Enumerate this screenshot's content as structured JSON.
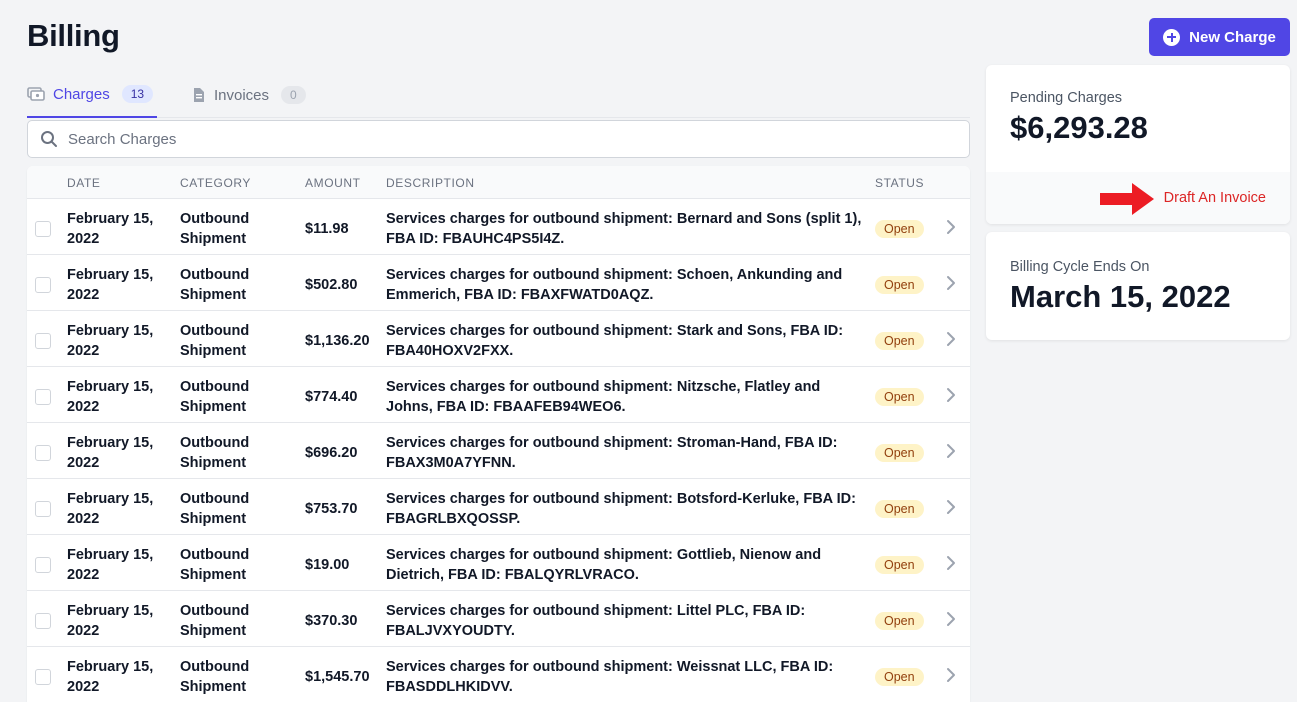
{
  "page": {
    "title": "Billing"
  },
  "actions": {
    "new_charge_label": "New Charge"
  },
  "tabs": [
    {
      "label": "Charges",
      "count": "13",
      "active": true
    },
    {
      "label": "Invoices",
      "count": "0",
      "active": false
    }
  ],
  "search": {
    "placeholder": "Search Charges",
    "value": ""
  },
  "table": {
    "headers": {
      "date": "DATE",
      "category": "CATEGORY",
      "amount": "AMOUNT",
      "description": "DESCRIPTION",
      "status": "STATUS"
    },
    "rows": [
      {
        "date": "February 15, 2022",
        "category": "Outbound Shipment",
        "amount": "$11.98",
        "description": "Services charges for outbound shipment: Bernard and Sons (split 1), FBA ID: FBAUHC4PS5I4Z.",
        "status": "Open"
      },
      {
        "date": "February 15, 2022",
        "category": "Outbound Shipment",
        "amount": "$502.80",
        "description": "Services charges for outbound shipment: Schoen, Ankunding and Emmerich, FBA ID: FBAXFWATD0AQZ.",
        "status": "Open"
      },
      {
        "date": "February 15, 2022",
        "category": "Outbound Shipment",
        "amount": "$1,136.20",
        "description": "Services charges for outbound shipment: Stark and Sons, FBA ID: FBA40HOXV2FXX.",
        "status": "Open"
      },
      {
        "date": "February 15, 2022",
        "category": "Outbound Shipment",
        "amount": "$774.40",
        "description": "Services charges for outbound shipment: Nitzsche, Flatley and Johns, FBA ID: FBAAFEB94WEO6.",
        "status": "Open"
      },
      {
        "date": "February 15, 2022",
        "category": "Outbound Shipment",
        "amount": "$696.20",
        "description": "Services charges for outbound shipment: Stroman-Hand, FBA ID: FBAX3M0A7YFNN.",
        "status": "Open"
      },
      {
        "date": "February 15, 2022",
        "category": "Outbound Shipment",
        "amount": "$753.70",
        "description": "Services charges for outbound shipment: Botsford-Kerluke, FBA ID: FBAGRLBXQOSSP.",
        "status": "Open"
      },
      {
        "date": "February 15, 2022",
        "category": "Outbound Shipment",
        "amount": "$19.00",
        "description": "Services charges for outbound shipment: Gottlieb, Nienow and Dietrich, FBA ID: FBALQYRLVRACO.",
        "status": "Open"
      },
      {
        "date": "February 15, 2022",
        "category": "Outbound Shipment",
        "amount": "$370.30",
        "description": "Services charges for outbound shipment: Littel PLC, FBA ID: FBALJVXYOUDTY.",
        "status": "Open"
      },
      {
        "date": "February 15, 2022",
        "category": "Outbound Shipment",
        "amount": "$1,545.70",
        "description": "Services charges for outbound shipment: Weissnat LLC, FBA ID: FBASDDLHKIDVV.",
        "status": "Open"
      }
    ]
  },
  "pending_card": {
    "label": "Pending Charges",
    "value": "$6,293.28",
    "link_label": "Draft An Invoice"
  },
  "cycle_card": {
    "label": "Billing Cycle Ends On",
    "value": "March 15, 2022"
  },
  "colors": {
    "accent": "#5046e5",
    "link_red": "#dc2626",
    "status_open_bg": "#fef3c7",
    "status_open_text": "#92400e"
  },
  "icons": {
    "charges_tab": "credit-card-icon",
    "invoices_tab": "document-icon",
    "search": "search-icon",
    "new_charge": "plus-circle-icon",
    "row_action": "chevron-right-icon",
    "annotation": "red-arrow-icon"
  }
}
